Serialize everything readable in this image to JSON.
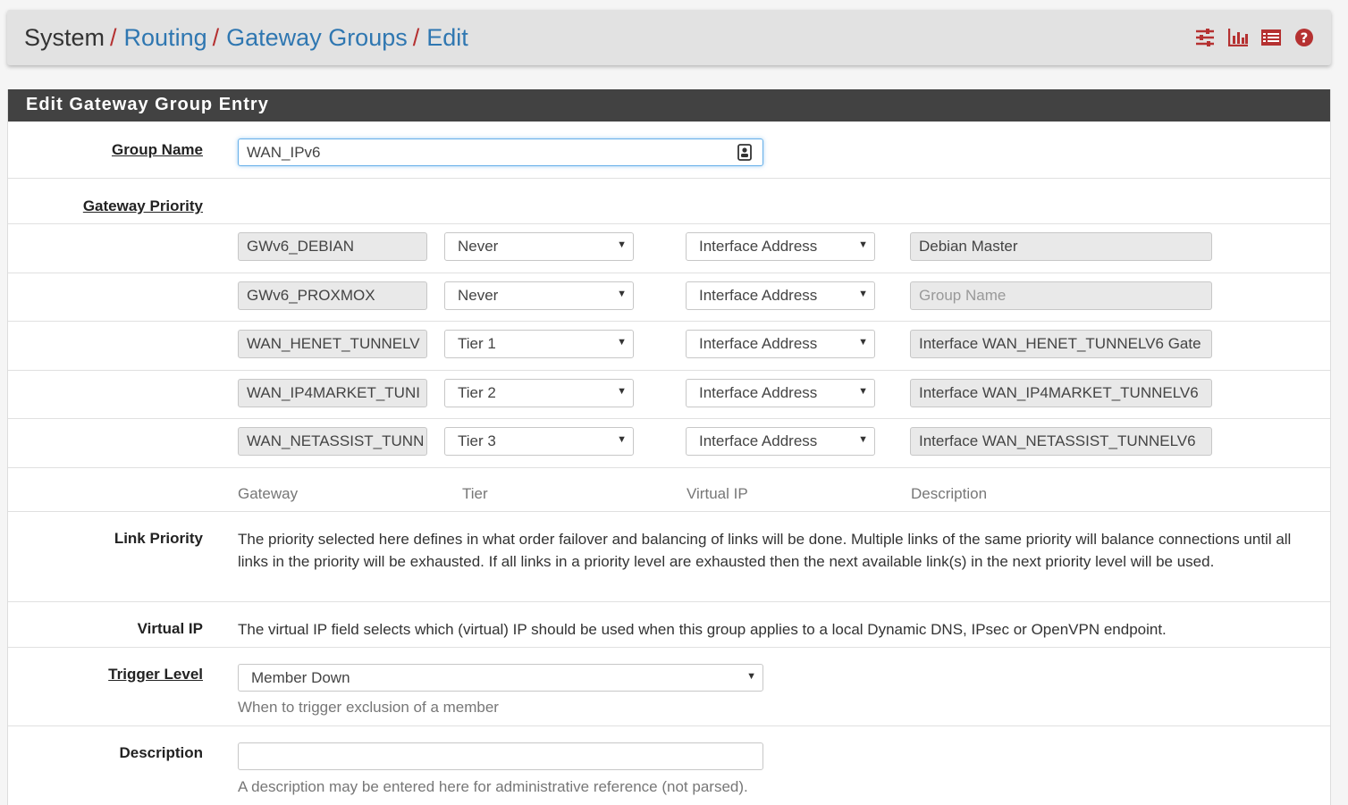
{
  "breadcrumb": {
    "system": "System",
    "routing": "Routing",
    "gateway_groups": "Gateway Groups",
    "edit": "Edit",
    "sep": "/"
  },
  "header_icons": [
    "sliders-icon",
    "bar-chart-icon",
    "log-list-icon",
    "help-icon"
  ],
  "panel_title": "Edit Gateway Group Entry",
  "group_name": {
    "label": "Group Name",
    "value": "WAN_IPv6"
  },
  "gateway_priority": {
    "label": "Gateway Priority",
    "rows": [
      {
        "gateway": "GWv6_DEBIAN",
        "tier": "Never",
        "vip": "Interface Address",
        "description": "Debian Master",
        "desc_placeholder": false
      },
      {
        "gateway": "GWv6_PROXMOX",
        "tier": "Never",
        "vip": "Interface Address",
        "description": "Group Name",
        "desc_placeholder": true
      },
      {
        "gateway": "WAN_HENET_TUNNELV",
        "tier": "Tier 1",
        "vip": "Interface Address",
        "description": "Interface WAN_HENET_TUNNELV6 Gate",
        "desc_placeholder": false
      },
      {
        "gateway": "WAN_IP4MARKET_TUNI",
        "tier": "Tier 2",
        "vip": "Interface Address",
        "description": "Interface WAN_IP4MARKET_TUNNELV6",
        "desc_placeholder": false
      },
      {
        "gateway": "WAN_NETASSIST_TUNN",
        "tier": "Tier 3",
        "vip": "Interface Address",
        "description": "Interface WAN_NETASSIST_TUNNELV6",
        "desc_placeholder": false
      }
    ],
    "columns": {
      "gateway": "Gateway",
      "tier": "Tier",
      "vip": "Virtual IP",
      "description": "Description"
    }
  },
  "link_priority": {
    "label": "Link Priority",
    "text": "The priority selected here defines in what order failover and balancing of links will be done. Multiple links of the same priority will balance connections until all links in the priority will be exhausted. If all links in a priority level are exhausted then the next available link(s) in the next priority level will be used."
  },
  "virtual_ip": {
    "label": "Virtual IP",
    "text": "The virtual IP field selects which (virtual) IP should be used when this group applies to a local Dynamic DNS, IPsec or OpenVPN endpoint."
  },
  "trigger_level": {
    "label": "Trigger Level",
    "value": "Member Down",
    "help": "When to trigger exclusion of a member"
  },
  "description": {
    "label": "Description",
    "value": "",
    "help": "A description may be entered here for administrative reference (not parsed)."
  },
  "colors": {
    "accent": "#2f77b1",
    "brand_red": "#b53131",
    "panel_header": "#424242"
  }
}
